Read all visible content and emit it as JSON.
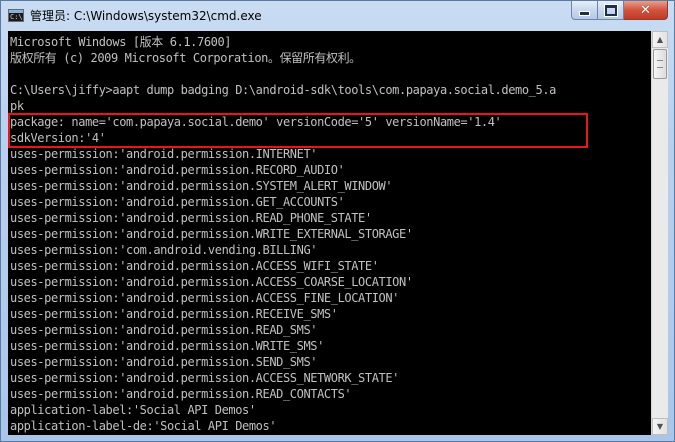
{
  "window": {
    "title": "管理员: C:\\Windows\\system32\\cmd.exe",
    "icon": "cmd-icon",
    "icon_label": "C:\\",
    "buttons": {
      "minimize": "minimize-icon",
      "maximize": "maximize-icon",
      "close_glyph": "✕"
    }
  },
  "colors": {
    "console_background": "#000000",
    "console_text": "#c0c0c0",
    "highlight_border": "#e8161b"
  },
  "console": {
    "lines": [
      "Microsoft Windows [版本 6.1.7600]",
      "版权所有 (c) 2009 Microsoft Corporation。保留所有权利。",
      "",
      "C:\\Users\\jiffy>aapt dump badging D:\\android-sdk\\tools\\com.papaya.social.demo_5.a",
      "pk",
      "package: name='com.papaya.social.demo' versionCode='5' versionName='1.4'",
      "sdkVersion:'4'",
      "uses-permission:'android.permission.INTERNET'",
      "uses-permission:'android.permission.RECORD_AUDIO'",
      "uses-permission:'android.permission.SYSTEM_ALERT_WINDOW'",
      "uses-permission:'android.permission.GET_ACCOUNTS'",
      "uses-permission:'android.permission.READ_PHONE_STATE'",
      "uses-permission:'android.permission.WRITE_EXTERNAL_STORAGE'",
      "uses-permission:'com.android.vending.BILLING'",
      "uses-permission:'android.permission.ACCESS_WIFI_STATE'",
      "uses-permission:'android.permission.ACCESS_COARSE_LOCATION'",
      "uses-permission:'android.permission.ACCESS_FINE_LOCATION'",
      "uses-permission:'android.permission.RECEIVE_SMS'",
      "uses-permission:'android.permission.READ_SMS'",
      "uses-permission:'android.permission.WRITE_SMS'",
      "uses-permission:'android.permission.SEND_SMS'",
      "uses-permission:'android.permission.ACCESS_NETWORK_STATE'",
      "uses-permission:'android.permission.READ_CONTACTS'",
      "application-label:'Social API Demos'",
      "application-label-de:'Social API Demos'"
    ]
  },
  "scrollbar": {
    "up_arrow": "▲",
    "down_arrow": "▼"
  }
}
